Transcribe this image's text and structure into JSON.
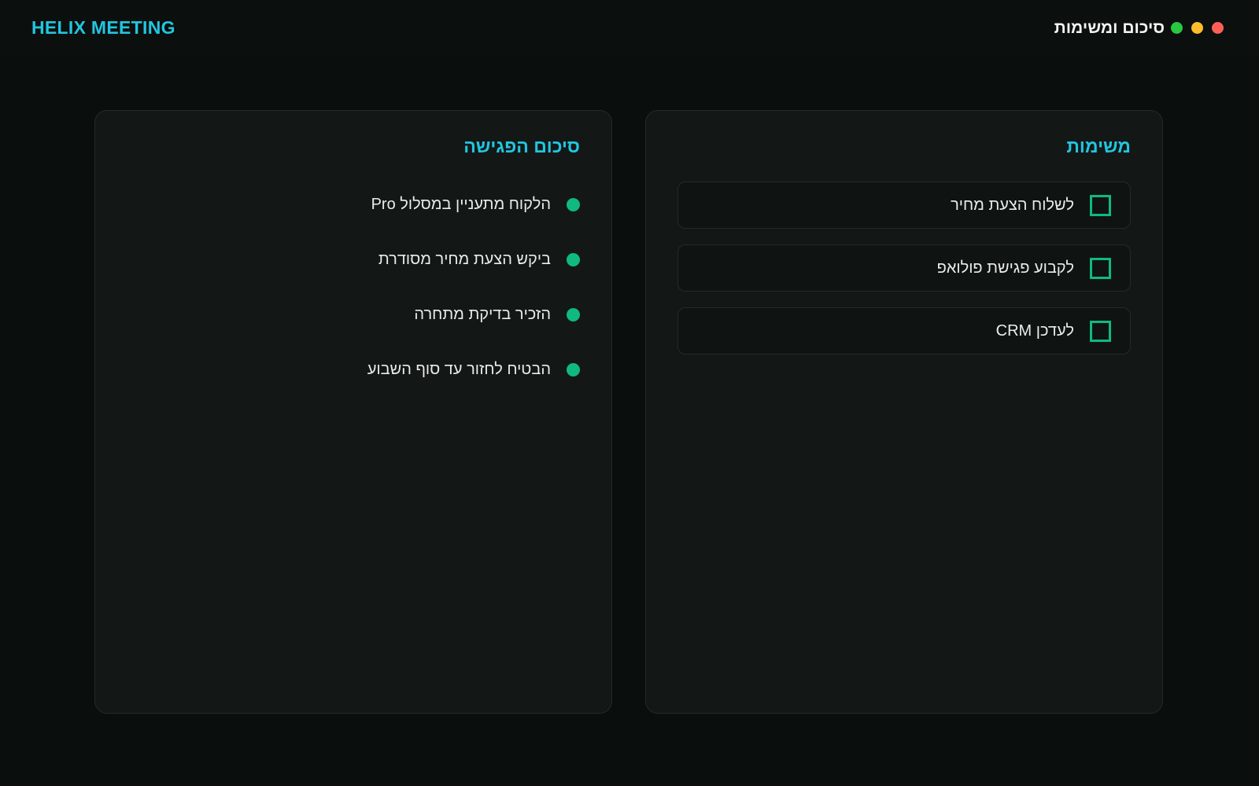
{
  "app": {
    "brand": "HELIX MEETING",
    "window_title": "סיכום ומשימות"
  },
  "window_controls": {
    "colors": {
      "green": "#28c840",
      "yellow": "#febc2e",
      "red": "#ff5f57"
    }
  },
  "summary": {
    "title": "סיכום הפגישה",
    "items": [
      "הלקוח מתעניין במסלול Pro",
      "ביקש הצעת מחיר מסודרת",
      "הזכיר בדיקת מתחרה",
      "הבטיח לחזור עד סוף השבוע"
    ]
  },
  "tasks": {
    "title": "משימות",
    "items": [
      {
        "label": "לשלוח הצעת מחיר",
        "checked": false
      },
      {
        "label": "לקבוע פגישת פולואפ",
        "checked": false
      },
      {
        "label": "לעדכן CRM",
        "checked": false
      }
    ]
  },
  "colors": {
    "accent": "#22c5e0",
    "bullet": "#10b981",
    "background": "#0a0e0d",
    "panel": "#131817"
  }
}
